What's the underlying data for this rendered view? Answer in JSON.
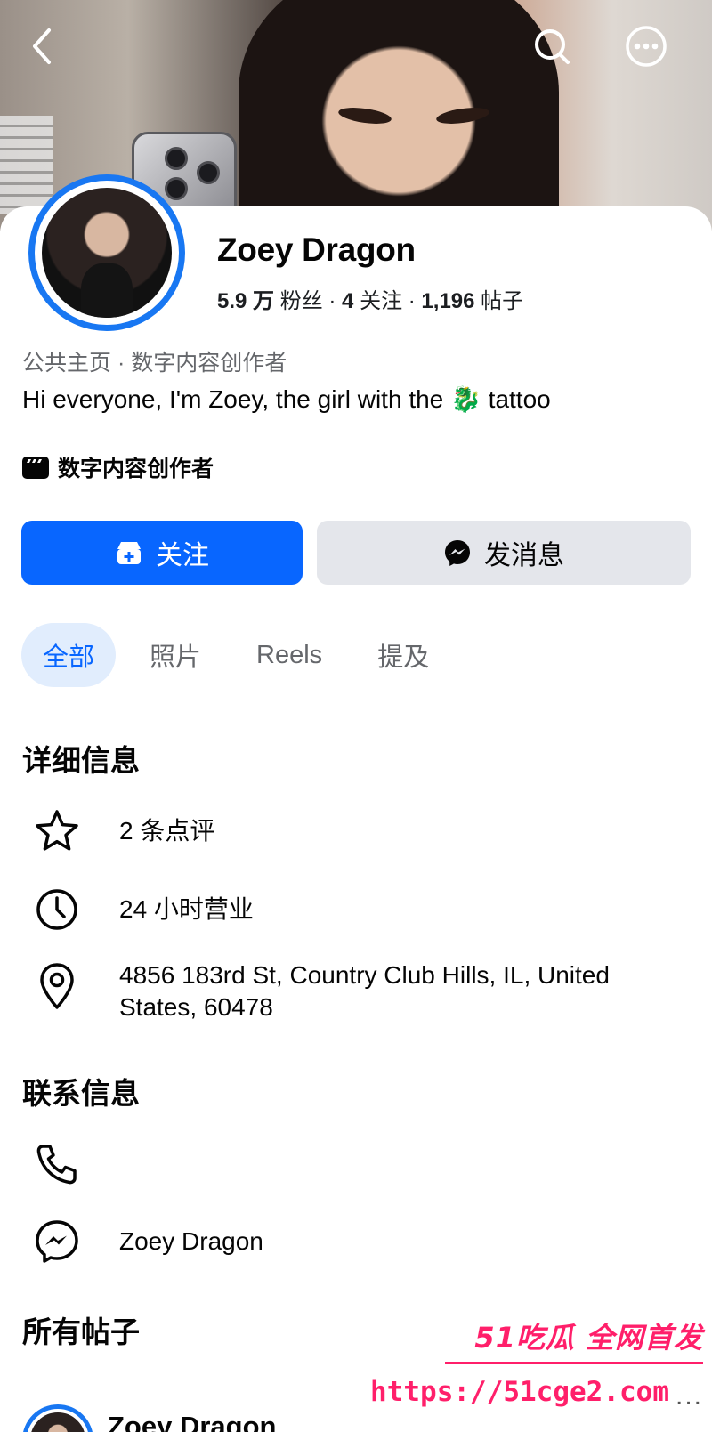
{
  "profile": {
    "name": "Zoey Dragon",
    "stats": {
      "followers_value": "5.9 万",
      "followers_label": "粉丝",
      "following_value": "4",
      "following_label": "关注",
      "posts_value": "1,196",
      "posts_label": "帖子",
      "separator": "·"
    },
    "category": "公共主页 · 数字内容创作者",
    "bio": "Hi everyone, I'm Zoey, the girl with the 🐉 tattoo",
    "creator_label": "数字内容创作者"
  },
  "actions": {
    "follow_label": "关注",
    "message_label": "发消息"
  },
  "tabs": [
    {
      "label": "全部"
    },
    {
      "label": "照片"
    },
    {
      "label": "Reels"
    },
    {
      "label": "提及"
    }
  ],
  "details": {
    "title": "详细信息",
    "reviews": "2 条点评",
    "hours": "24 小时营业",
    "address": "4856 183rd St, Country Club Hills, IL, United States, 60478"
  },
  "contact": {
    "title": "联系信息",
    "messenger": "Zoey Dragon"
  },
  "posts": {
    "title": "所有帖子",
    "first_author": "Zoey Dragon"
  },
  "watermark": {
    "brand": "51吃瓜 全网首发",
    "url": "https://51cge2.com",
    "more": "..."
  },
  "colors": {
    "accent": "#0866ff",
    "ring": "#1877f2",
    "watermark": "#ff1f6a"
  },
  "icons": [
    "back-icon",
    "search-icon",
    "more-icon",
    "follow-icon",
    "messenger-icon",
    "star-icon",
    "clock-icon",
    "location-pin-icon",
    "phone-icon",
    "creator-icon"
  ]
}
